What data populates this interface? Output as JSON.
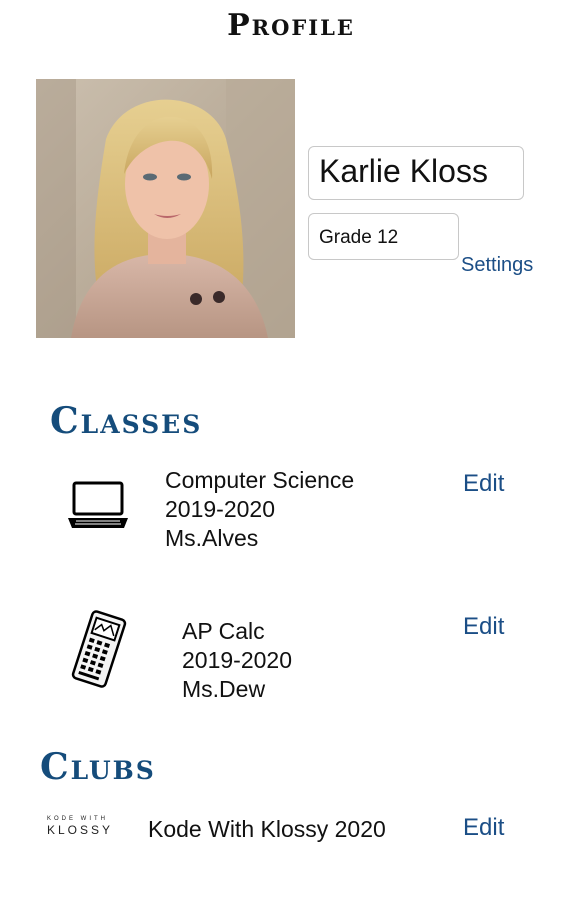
{
  "header": {
    "title": "Profile"
  },
  "profile": {
    "name": "Karlie Kloss",
    "grade": "Grade 12",
    "settings_label": "Settings"
  },
  "classes": {
    "title": "Classes",
    "items": [
      {
        "name": "Computer Science",
        "year": "2019-2020",
        "teacher": "Ms.Alves",
        "edit_label": "Edit",
        "icon": "laptop-icon"
      },
      {
        "name": "AP Calc",
        "year": "2019-2020",
        "teacher": "Ms.Dew",
        "edit_label": "Edit",
        "icon": "calculator-icon"
      }
    ]
  },
  "clubs": {
    "title": "Clubs",
    "items": [
      {
        "logo_text_top": "KODE WITH",
        "logo_text_bottom": "KLOSSY",
        "name": "Kode With Klossy 2020",
        "edit_label": "Edit",
        "icon": "kode-with-klossy-logo"
      }
    ]
  },
  "colors": {
    "section_title": "#154c7b",
    "link": "#1b4e86"
  }
}
